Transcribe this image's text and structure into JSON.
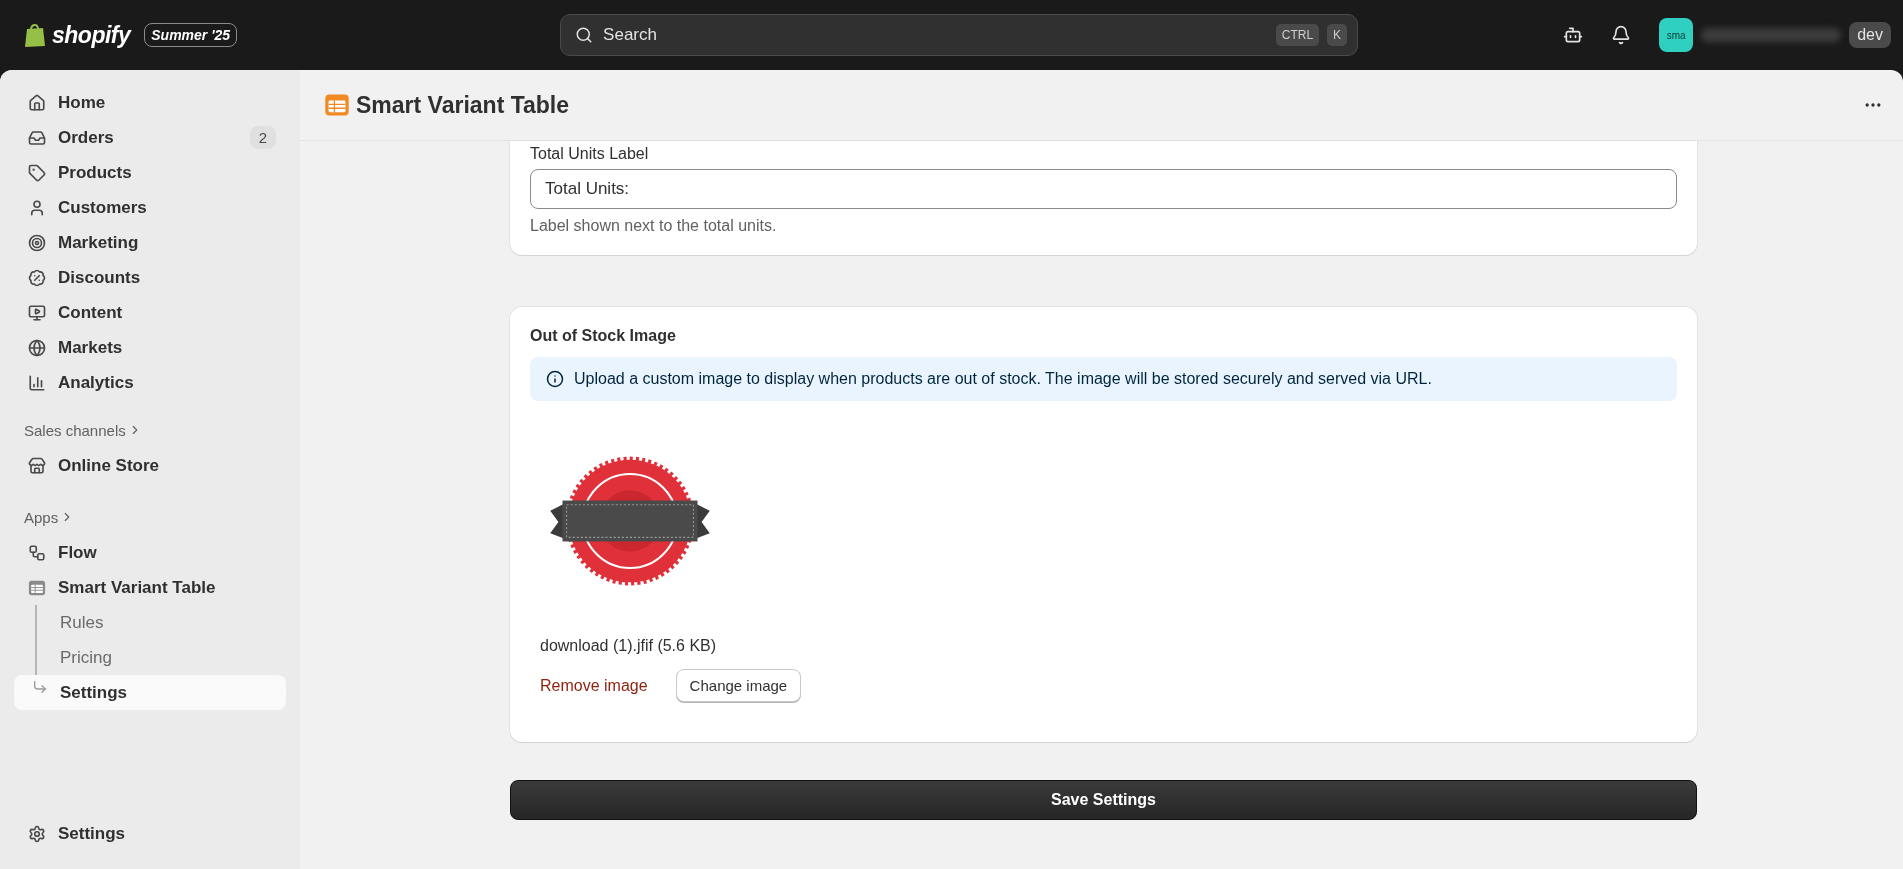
{
  "topbar": {
    "logo": "shopify",
    "edition_badge": "Summer '25",
    "search": {
      "placeholder": "Search",
      "shortcut": [
        "CTRL",
        "K"
      ]
    },
    "account": {
      "avatar": "sma",
      "store_badge": "dev"
    }
  },
  "sidebar": {
    "main_items": [
      {
        "label": "Home",
        "selected": false
      },
      {
        "label": "Orders",
        "badge": "2",
        "selected": false
      },
      {
        "label": "Products",
        "selected": false
      },
      {
        "label": "Customers",
        "selected": false
      },
      {
        "label": "Marketing",
        "selected": false
      },
      {
        "label": "Discounts",
        "selected": false
      },
      {
        "label": "Content",
        "selected": false
      },
      {
        "label": "Markets",
        "selected": false
      },
      {
        "label": "Analytics",
        "selected": false
      }
    ],
    "sales_channels": {
      "heading": "Sales channels",
      "items": [
        {
          "label": "Online Store",
          "selected": false
        }
      ]
    },
    "apps": {
      "heading": "Apps",
      "items": [
        {
          "label": "Flow",
          "selected": false
        },
        {
          "label": "Smart Variant Table",
          "selected": false,
          "children": [
            {
              "label": "Rules",
              "selected": false
            },
            {
              "label": "Pricing",
              "selected": false
            },
            {
              "label": "Settings",
              "selected": true
            }
          ]
        }
      ]
    },
    "footer_item": {
      "label": "Settings",
      "selected": false
    }
  },
  "page": {
    "title": "Smart Variant Table",
    "cards": [
      {
        "kind": "field",
        "label": "Total Units Label",
        "value": "Total Units:",
        "help": "Label shown next to the total units."
      },
      {
        "title": "Out of Stock Image",
        "banner": "Upload a custom image to display when products are out of stock. The image will be stored securely and served via URL.",
        "file_name": "download (1).jfif (5.6 KB)",
        "remove_link": "Remove image",
        "change_button": "Change image"
      }
    ],
    "save_button": "Save Settings"
  }
}
